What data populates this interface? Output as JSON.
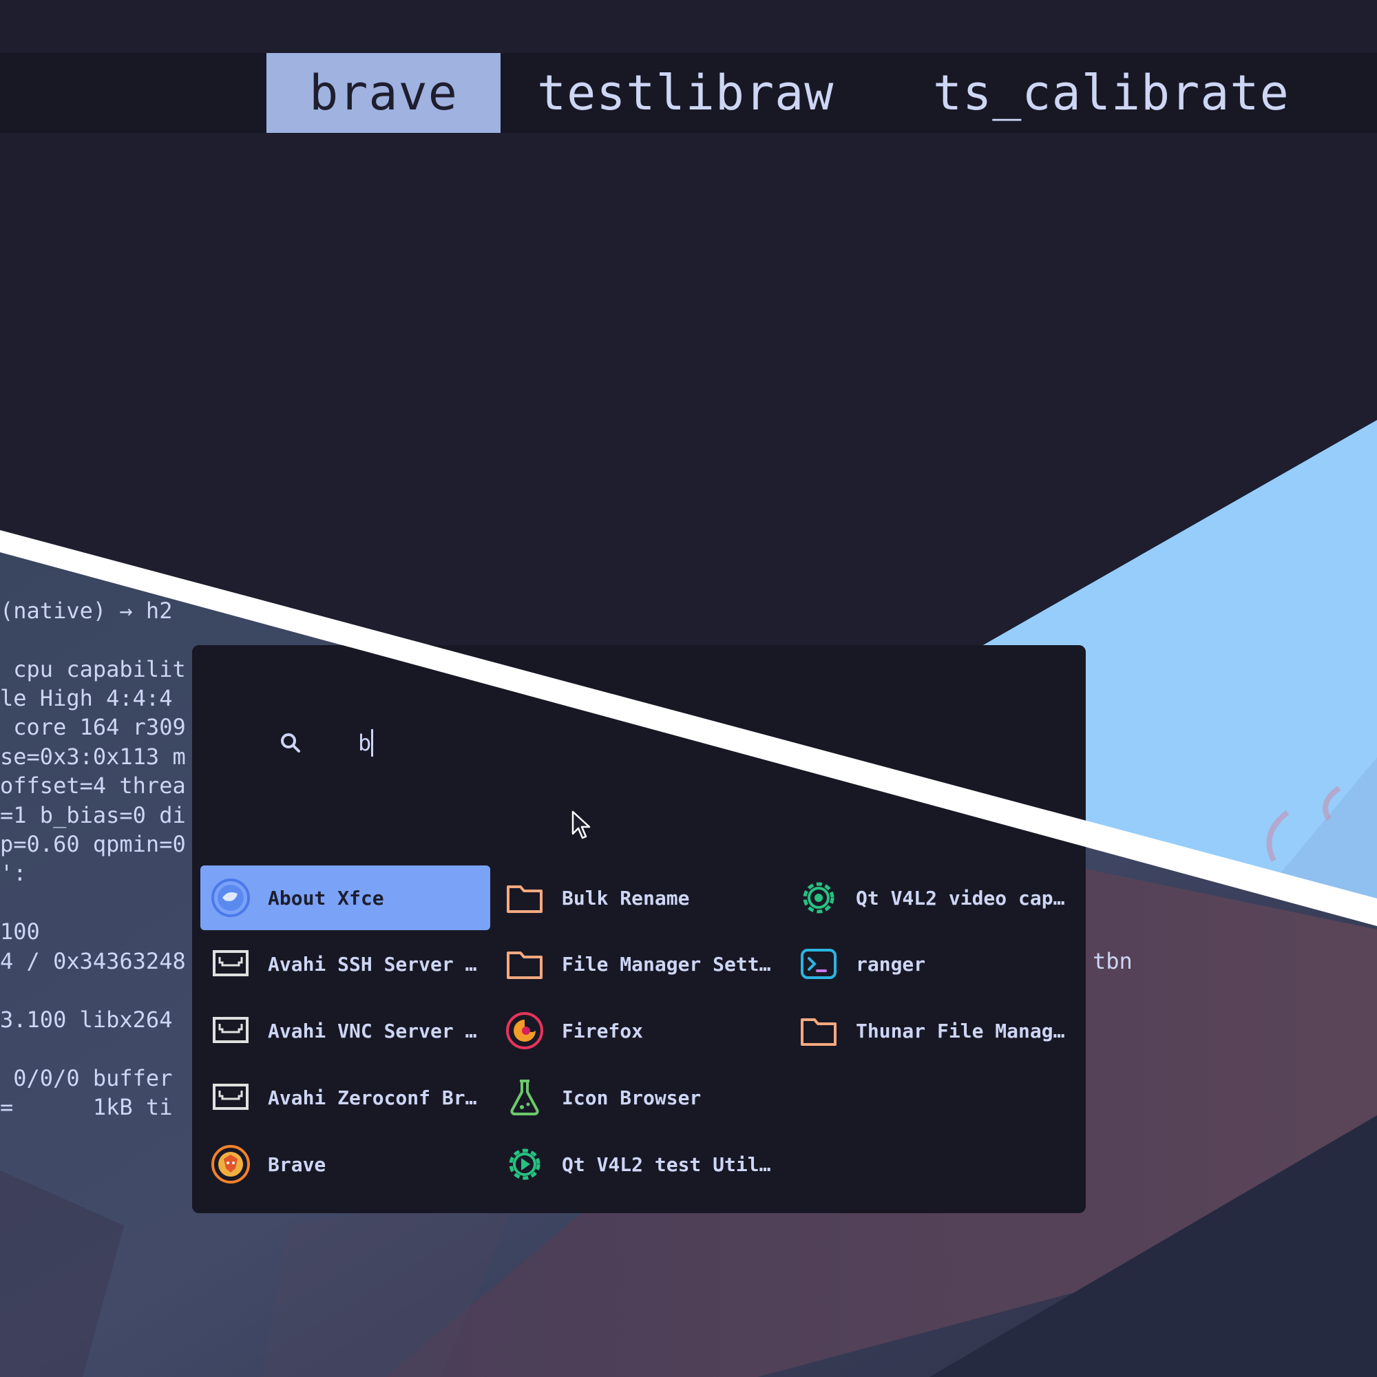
{
  "top_bar": {
    "items": [
      "brave",
      "testlibraw",
      "ts_calibrate"
    ],
    "selected_index": 0
  },
  "terminal": {
    "lines": [
      "(native) → h2",
      "",
      " cpu capabilit",
      "le High 4:4:4",
      " core 164 r309",
      "se=0x3:0x113 m",
      "offset=4 threa",
      "=1 b_bias=0 di",
      "p=0.60 qpmin=0",
      "':",
      "",
      "100",
      "4 / 0x34363248",
      "",
      "3.100 libx264",
      "",
      " 0/0/0 buffer",
      "=      1kB ti"
    ],
    "right_fragment": "tbn"
  },
  "launcher": {
    "search_query": "b",
    "columns": [
      [
        {
          "label": "About Xfce",
          "icon": "xfce-mouse-icon",
          "selected": true
        },
        {
          "label": "Avahi SSH Server …",
          "icon": "network-port-icon"
        },
        {
          "label": "Avahi VNC Server …",
          "icon": "network-port-icon"
        },
        {
          "label": "Avahi Zeroconf Br…",
          "icon": "network-port-icon"
        },
        {
          "label": "Brave",
          "icon": "brave-lion-icon"
        }
      ],
      [
        {
          "label": "Bulk Rename",
          "icon": "folder-icon"
        },
        {
          "label": "File Manager Sett…",
          "icon": "folder-icon"
        },
        {
          "label": "Firefox",
          "icon": "firefox-icon"
        },
        {
          "label": "Icon Browser",
          "icon": "flask-icon"
        },
        {
          "label": "Qt V4L2 test Util…",
          "icon": "gear-play-icon"
        }
      ],
      [
        {
          "label": "Qt V4L2 video cap…",
          "icon": "gear-camera-icon"
        },
        {
          "label": "ranger",
          "icon": "terminal-icon"
        },
        {
          "label": "Thunar File Manag…",
          "icon": "folder-icon"
        }
      ]
    ]
  },
  "colors": {
    "background": "#1e1e2e",
    "bar": "#181825",
    "selection": "#7aa2f7",
    "top_selection": "#9fb2e0",
    "text": "#cdd6f4",
    "folder": "#f5a97f",
    "accent_green": "#40c080",
    "wallpaper_blue": "#96cdfb"
  }
}
